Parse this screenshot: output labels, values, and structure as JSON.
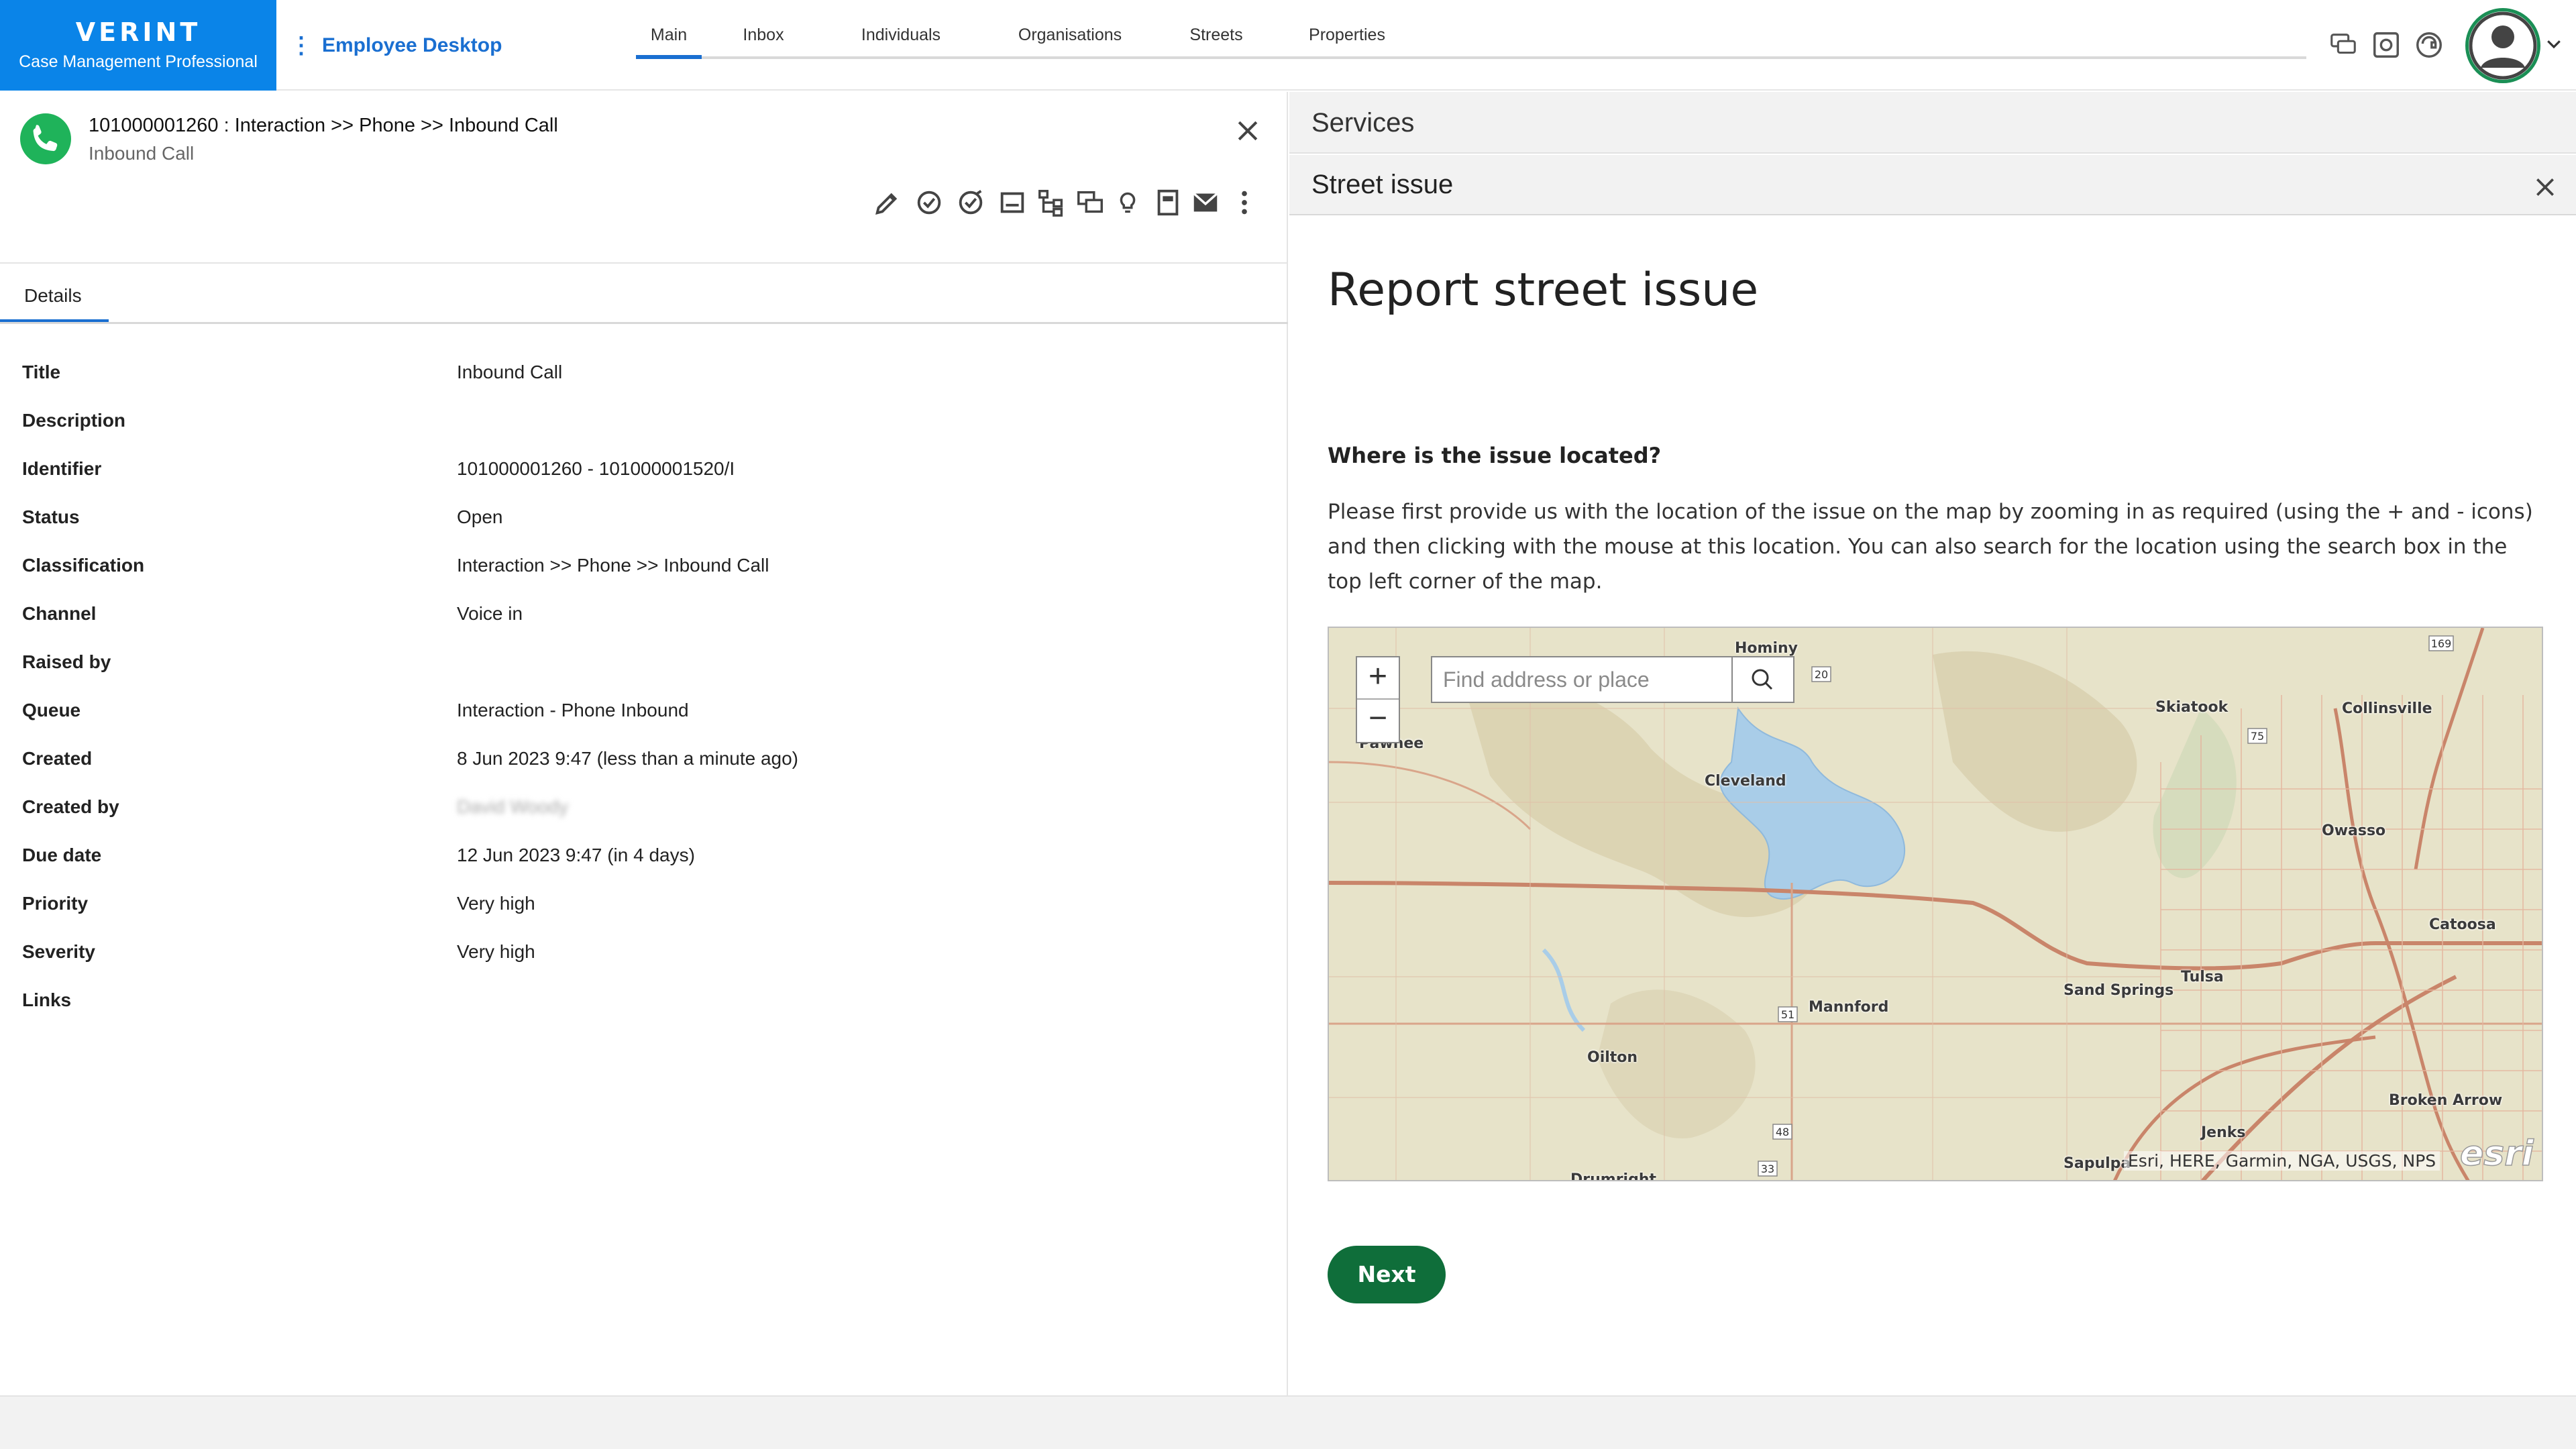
{
  "brand": {
    "name": "VERINT",
    "product": "Case Management Professional"
  },
  "app_menu": {
    "label": "Employee Desktop"
  },
  "nav": {
    "tabs": [
      {
        "label": "Main",
        "active": true
      },
      {
        "label": "Inbox"
      },
      {
        "label": "Individuals"
      },
      {
        "label": "Organisations"
      },
      {
        "label": "Streets"
      },
      {
        "label": "Properties"
      }
    ]
  },
  "case": {
    "title": "101000001260 : Interaction >> Phone >> Inbound Call",
    "subtitle": "Inbound Call",
    "toolbar_icons": [
      "edit-icon",
      "complete-icon",
      "assign-icon",
      "note-icon",
      "hierarchy-icon",
      "chat-icon",
      "idea-icon",
      "document-icon",
      "email-icon",
      "more-icon"
    ],
    "tab": "Details",
    "fields": [
      {
        "label": "Title",
        "value": "Inbound Call"
      },
      {
        "label": "Description",
        "value": ""
      },
      {
        "label": "Identifier",
        "value": "101000001260 - 101000001520/I"
      },
      {
        "label": "Status",
        "value": "Open"
      },
      {
        "label": "Classification",
        "value": "Interaction >> Phone >> Inbound Call"
      },
      {
        "label": "Channel",
        "value": "Voice in"
      },
      {
        "label": "Raised by",
        "value": ""
      },
      {
        "label": "Queue",
        "value": "Interaction - Phone Inbound"
      },
      {
        "label": "Created",
        "value": "8 Jun 2023 9:47 (less than a minute ago)"
      },
      {
        "label": "Created by",
        "value": "David Woody",
        "redacted": true
      },
      {
        "label": "Due date",
        "value": "12 Jun 2023 9:47 (in 4 days)"
      },
      {
        "label": "Priority",
        "value": "Very high"
      },
      {
        "label": "Severity",
        "value": "Very high"
      },
      {
        "label": "Links",
        "value": ""
      }
    ]
  },
  "services": {
    "title": "Services",
    "panel_title": "Street issue",
    "form": {
      "heading": "Report street issue",
      "question": "Where is the issue located?",
      "instructions": "Please first provide us with the location of the issue on the map by zooming in as required (using the + and - icons) and then clicking with the mouse at this location. You can also search for the location using the search box in the top left corner of the map.",
      "map": {
        "search_placeholder": "Find address or place",
        "zoom_in": "+",
        "zoom_out": "−",
        "attribution": "Esri, HERE, Garmin, NGA, USGS, NPS",
        "logo": "esri",
        "places": [
          "Hominy",
          "Pawnee",
          "Skiatook",
          "Collinsville",
          "Cleveland",
          "Owasso",
          "Catoosa",
          "Tulsa",
          "Sand Springs",
          "Mannford",
          "Oilton",
          "Broken Arrow",
          "Jenks",
          "Sapulpa",
          "Drumright"
        ],
        "route_shields": [
          "169",
          "20",
          "75",
          "51",
          "48",
          "33"
        ]
      },
      "next_label": "Next"
    }
  },
  "colors": {
    "brand": "#0a84e8",
    "accent": "#1a6fd1",
    "call": "#1fb35a",
    "next": "#0f6e3a"
  }
}
